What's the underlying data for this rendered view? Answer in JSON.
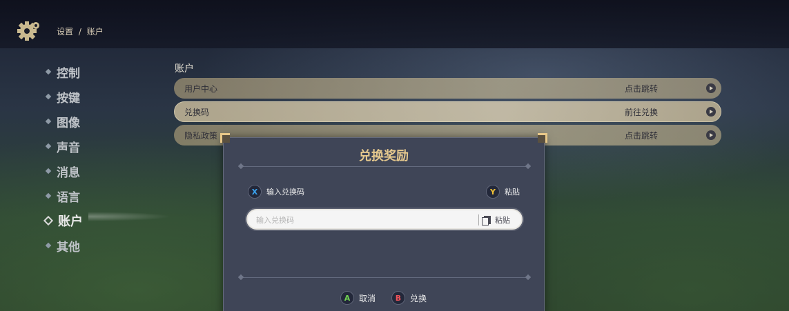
{
  "header": {
    "breadcrumb": {
      "root": "设置",
      "separator": "/",
      "current": "账户"
    }
  },
  "sidebar": {
    "items": [
      {
        "label": "控制",
        "active": false
      },
      {
        "label": "按键",
        "active": false
      },
      {
        "label": "图像",
        "active": false
      },
      {
        "label": "声音",
        "active": false
      },
      {
        "label": "消息",
        "active": false
      },
      {
        "label": "语言",
        "active": false
      },
      {
        "label": "账户",
        "active": true
      },
      {
        "label": "其他",
        "active": false
      }
    ]
  },
  "main": {
    "section_title": "账户",
    "rows": [
      {
        "label": "用户中心",
        "action": "点击跳转"
      },
      {
        "label": "兑换码",
        "action": "前往兑换"
      },
      {
        "label": "隐私政策",
        "action": "点击跳转"
      }
    ]
  },
  "dialog": {
    "title": "兑换奖励",
    "hint_left": {
      "key": "X",
      "label": "输入兑换码"
    },
    "hint_right": {
      "key": "Y",
      "label": "粘贴"
    },
    "input": {
      "placeholder": "输入兑换码",
      "value": ""
    },
    "paste_label": "粘贴",
    "cancel": {
      "key": "A",
      "label": "取消"
    },
    "confirm": {
      "key": "B",
      "label": "兑换"
    }
  },
  "colors": {
    "title_gold": "#e6c98e",
    "dialog_bg": "#3f4557",
    "row_bg": "#c4b694",
    "x_button": "#3aa3f0",
    "y_button": "#f2c236",
    "a_button": "#71d353",
    "b_button": "#f0535a"
  }
}
